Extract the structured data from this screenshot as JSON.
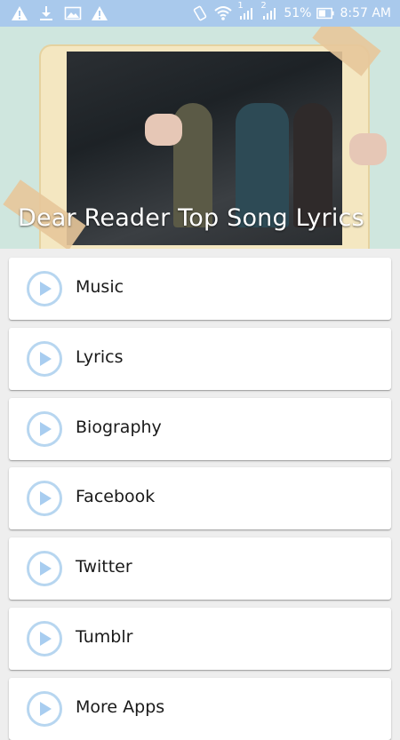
{
  "status_bar": {
    "battery": "51%",
    "time": "8:57 AM",
    "sim1": "1",
    "sim2": "2"
  },
  "header": {
    "title": "Dear Reader Top Song Lyrics"
  },
  "menu": {
    "items": [
      {
        "label": "Music"
      },
      {
        "label": "Lyrics"
      },
      {
        "label": "Biography"
      },
      {
        "label": "Facebook"
      },
      {
        "label": "Twitter"
      },
      {
        "label": "Tumblr"
      },
      {
        "label": "More Apps"
      }
    ]
  },
  "colors": {
    "status_bar": "#a9c9ec",
    "play_icon": "#b7d6f0",
    "background": "#eeeeee"
  }
}
